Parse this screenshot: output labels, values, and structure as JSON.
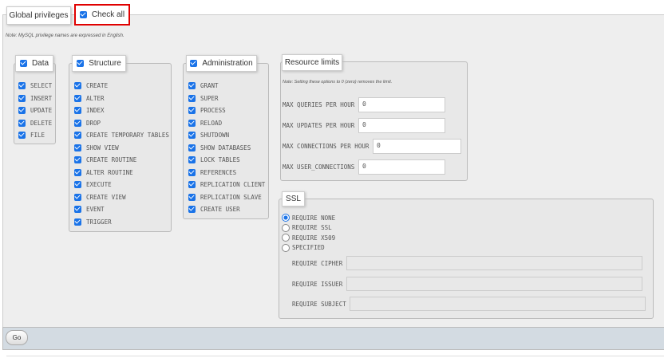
{
  "header": {
    "title": "Global privileges",
    "check_all": "Check all"
  },
  "note": "Note: MySQL privilege names are expressed in English.",
  "groups": {
    "data": {
      "label": "Data",
      "items": [
        "SELECT",
        "INSERT",
        "UPDATE",
        "DELETE",
        "FILE"
      ]
    },
    "structure": {
      "label": "Structure",
      "items": [
        "CREATE",
        "ALTER",
        "INDEX",
        "DROP",
        "CREATE TEMPORARY TABLES",
        "SHOW VIEW",
        "CREATE ROUTINE",
        "ALTER ROUTINE",
        "EXECUTE",
        "CREATE VIEW",
        "EVENT",
        "TRIGGER"
      ]
    },
    "administration": {
      "label": "Administration",
      "items": [
        "GRANT",
        "SUPER",
        "PROCESS",
        "RELOAD",
        "SHUTDOWN",
        "SHOW DATABASES",
        "LOCK TABLES",
        "REFERENCES",
        "REPLICATION CLIENT",
        "REPLICATION SLAVE",
        "CREATE USER"
      ]
    }
  },
  "resource_limits": {
    "label": "Resource limits",
    "note": "Note: Setting these options to 0 (zero) removes the limit.",
    "fields": [
      {
        "label": "MAX QUERIES PER HOUR",
        "value": "0"
      },
      {
        "label": "MAX UPDATES PER HOUR",
        "value": "0"
      },
      {
        "label": "MAX CONNECTIONS PER HOUR",
        "value": "0"
      },
      {
        "label": "MAX USER_CONNECTIONS",
        "value": "0"
      }
    ]
  },
  "ssl": {
    "label": "SSL",
    "options": [
      "REQUIRE NONE",
      "REQUIRE SSL",
      "REQUIRE X509",
      "SPECIFIED"
    ],
    "selected": "REQUIRE NONE",
    "fields": [
      {
        "label": "REQUIRE CIPHER",
        "value": ""
      },
      {
        "label": "REQUIRE ISSUER",
        "value": ""
      },
      {
        "label": "REQUIRE SUBJECT",
        "value": ""
      }
    ]
  },
  "footer": {
    "go": "Go"
  },
  "colors": {
    "accent": "#1a73e8",
    "highlight": "#e00000",
    "footer_bg": "#d3dbe2"
  }
}
